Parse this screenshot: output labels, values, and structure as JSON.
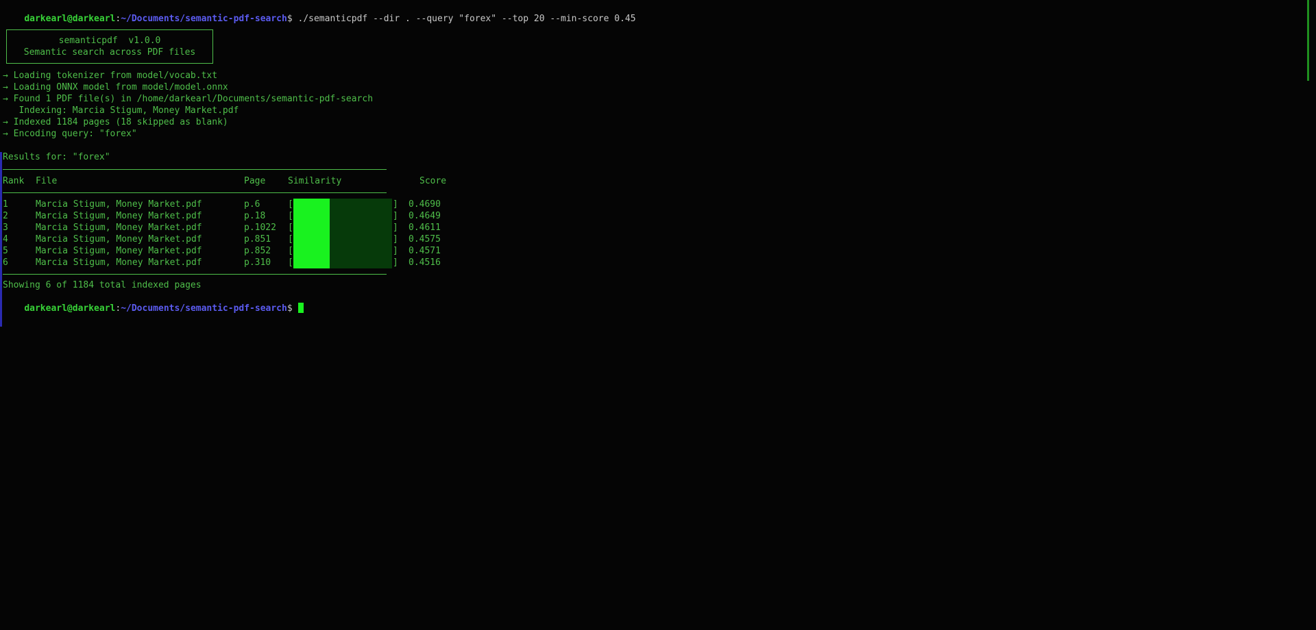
{
  "prompt": {
    "user_host": "darkearl@darkearl",
    "colon": ":",
    "path": "~/Documents/semantic-pdf-search",
    "dollar": "$",
    "command": " ./semanticpdf --dir . --query \"forex\" --top 20 --min-score 0.45"
  },
  "banner": {
    "line1": "semanticpdf  v1.0.0",
    "line2": "Semantic search across PDF files"
  },
  "log": [
    "→ Loading tokenizer from model/vocab.txt",
    "→ Loading ONNX model from model/model.onnx",
    "→ Found 1 PDF file(s) in /home/darkearl/Documents/semantic-pdf-search",
    "   Indexing: Marcia Stigum, Money Market.pdf",
    "→ Indexed 1184 pages (18 skipped as blank)",
    "→ Encoding query: \"forex\""
  ],
  "results": {
    "heading": "Results for: \"forex\"",
    "headers": {
      "rank": "Rank",
      "file": "File",
      "page": "Page",
      "similarity": "Similarity",
      "score": "Score"
    },
    "rows": [
      {
        "rank": "1",
        "file": "Marcia Stigum, Money Market.pdf",
        "page": "p.6",
        "score": "0.4690",
        "fill": 0.37
      },
      {
        "rank": "2",
        "file": "Marcia Stigum, Money Market.pdf",
        "page": "p.18",
        "score": "0.4649",
        "fill": 0.37
      },
      {
        "rank": "3",
        "file": "Marcia Stigum, Money Market.pdf",
        "page": "p.1022",
        "score": "0.4611",
        "fill": 0.37
      },
      {
        "rank": "4",
        "file": "Marcia Stigum, Money Market.pdf",
        "page": "p.851",
        "score": "0.4575",
        "fill": 0.37
      },
      {
        "rank": "5",
        "file": "Marcia Stigum, Money Market.pdf",
        "page": "p.852",
        "score": "0.4571",
        "fill": 0.37
      },
      {
        "rank": "6",
        "file": "Marcia Stigum, Money Market.pdf",
        "page": "p.310",
        "score": "0.4516",
        "fill": 0.37
      }
    ],
    "bracket_open": "[",
    "bracket_close": "]",
    "footer": "Showing 6 of 1184 total indexed pages"
  },
  "colors": {
    "background": "#050505",
    "text_green": "#4fbf4a",
    "user_green": "#38d438",
    "path_blue": "#5b5bf0",
    "bar_bright": "#19f21f",
    "bar_dark": "#063a0a"
  }
}
